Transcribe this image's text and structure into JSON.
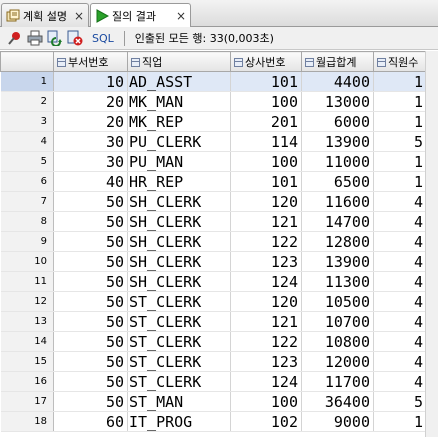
{
  "tabs": [
    {
      "label": "계획 설명",
      "icon": "explain-plan-icon",
      "active": false
    },
    {
      "label": "질의 결과",
      "icon": "run-icon",
      "active": true
    }
  ],
  "tab_close_glyph": "×",
  "toolbar": {
    "sql_label": "SQL",
    "status": "인출된 모든 행: 33(0,003초)"
  },
  "columns": [
    "",
    "부서번호",
    "직업",
    "상사번호",
    "월급합계",
    "직원수"
  ],
  "rows": [
    {
      "num": "1",
      "dept": "10",
      "job": "AD_ASST",
      "mgr": "101",
      "sum": "4400",
      "cnt": "1"
    },
    {
      "num": "2",
      "dept": "20",
      "job": "MK_MAN",
      "mgr": "100",
      "sum": "13000",
      "cnt": "1"
    },
    {
      "num": "3",
      "dept": "20",
      "job": "MK_REP",
      "mgr": "201",
      "sum": "6000",
      "cnt": "1"
    },
    {
      "num": "4",
      "dept": "30",
      "job": "PU_CLERK",
      "mgr": "114",
      "sum": "13900",
      "cnt": "5"
    },
    {
      "num": "5",
      "dept": "30",
      "job": "PU_MAN",
      "mgr": "100",
      "sum": "11000",
      "cnt": "1"
    },
    {
      "num": "6",
      "dept": "40",
      "job": "HR_REP",
      "mgr": "101",
      "sum": "6500",
      "cnt": "1"
    },
    {
      "num": "7",
      "dept": "50",
      "job": "SH_CLERK",
      "mgr": "120",
      "sum": "11600",
      "cnt": "4"
    },
    {
      "num": "8",
      "dept": "50",
      "job": "SH_CLERK",
      "mgr": "121",
      "sum": "14700",
      "cnt": "4"
    },
    {
      "num": "9",
      "dept": "50",
      "job": "SH_CLERK",
      "mgr": "122",
      "sum": "12800",
      "cnt": "4"
    },
    {
      "num": "10",
      "dept": "50",
      "job": "SH_CLERK",
      "mgr": "123",
      "sum": "13900",
      "cnt": "4"
    },
    {
      "num": "11",
      "dept": "50",
      "job": "SH_CLERK",
      "mgr": "124",
      "sum": "11300",
      "cnt": "4"
    },
    {
      "num": "12",
      "dept": "50",
      "job": "ST_CLERK",
      "mgr": "120",
      "sum": "10500",
      "cnt": "4"
    },
    {
      "num": "13",
      "dept": "50",
      "job": "ST_CLERK",
      "mgr": "121",
      "sum": "10700",
      "cnt": "4"
    },
    {
      "num": "14",
      "dept": "50",
      "job": "ST_CLERK",
      "mgr": "122",
      "sum": "10800",
      "cnt": "4"
    },
    {
      "num": "15",
      "dept": "50",
      "job": "ST_CLERK",
      "mgr": "123",
      "sum": "12000",
      "cnt": "4"
    },
    {
      "num": "16",
      "dept": "50",
      "job": "ST_CLERK",
      "mgr": "124",
      "sum": "11700",
      "cnt": "4"
    },
    {
      "num": "17",
      "dept": "50",
      "job": "ST_MAN",
      "mgr": "100",
      "sum": "36400",
      "cnt": "5"
    },
    {
      "num": "18",
      "dept": "60",
      "job": "IT_PROG",
      "mgr": "102",
      "sum": "9000",
      "cnt": "1"
    }
  ],
  "selected_row": 0,
  "colors": {
    "run_green": "#2aa12a",
    "pin_red": "#d02020",
    "selection": "#dfe8f6"
  }
}
